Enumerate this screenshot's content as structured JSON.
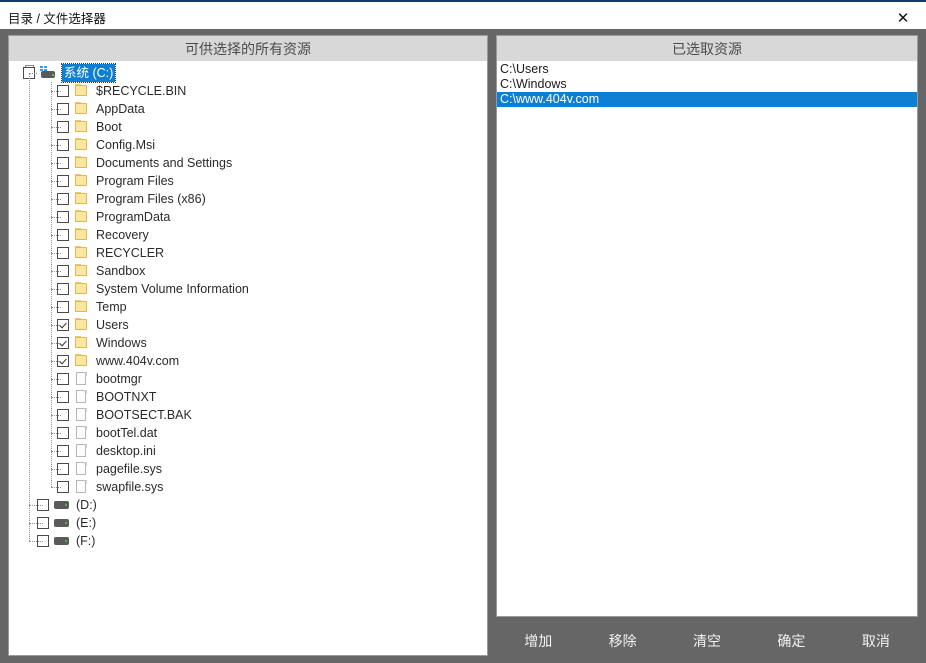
{
  "window": {
    "title": "目录 / 文件选择器",
    "close_icon": "close-icon"
  },
  "colors": {
    "accent_top": "#123a63",
    "selection_blue": "#0f7fd4",
    "chrome_gray": "#666666",
    "panel_header_gray": "#d8d8d8",
    "folder_yellow": "#fbe7a1"
  },
  "left_panel": {
    "header": "可供选择的所有资源",
    "root": {
      "label": "系统 (C:)",
      "icon": "system-drive-icon",
      "checked": false,
      "selected": true,
      "expanded": true
    },
    "children": [
      {
        "label": "$RECYCLE.BIN",
        "icon": "folder-icon",
        "checked": false
      },
      {
        "label": "AppData",
        "icon": "folder-icon",
        "checked": false
      },
      {
        "label": "Boot",
        "icon": "folder-icon",
        "checked": false
      },
      {
        "label": "Config.Msi",
        "icon": "folder-icon",
        "checked": false
      },
      {
        "label": "Documents and Settings",
        "icon": "folder-icon",
        "checked": false
      },
      {
        "label": "Program Files",
        "icon": "folder-icon",
        "checked": false
      },
      {
        "label": "Program Files (x86)",
        "icon": "folder-icon",
        "checked": false
      },
      {
        "label": "ProgramData",
        "icon": "folder-icon",
        "checked": false
      },
      {
        "label": "Recovery",
        "icon": "folder-icon",
        "checked": false
      },
      {
        "label": "RECYCLER",
        "icon": "folder-icon",
        "checked": false
      },
      {
        "label": "Sandbox",
        "icon": "folder-icon",
        "checked": false
      },
      {
        "label": "System Volume Information",
        "icon": "folder-icon",
        "checked": false
      },
      {
        "label": "Temp",
        "icon": "folder-icon",
        "checked": false
      },
      {
        "label": "Users",
        "icon": "folder-icon",
        "checked": true
      },
      {
        "label": "Windows",
        "icon": "folder-icon",
        "checked": true
      },
      {
        "label": "www.404v.com",
        "icon": "folder-icon",
        "checked": true
      },
      {
        "label": "bootmgr",
        "icon": "file-icon",
        "checked": false
      },
      {
        "label": "BOOTNXT",
        "icon": "file-icon",
        "checked": false
      },
      {
        "label": "BOOTSECT.BAK",
        "icon": "file-icon",
        "checked": false
      },
      {
        "label": "bootTel.dat",
        "icon": "file-icon",
        "checked": false
      },
      {
        "label": "desktop.ini",
        "icon": "file-icon",
        "checked": false
      },
      {
        "label": "pagefile.sys",
        "icon": "file-icon",
        "checked": false
      },
      {
        "label": "swapfile.sys",
        "icon": "file-icon",
        "checked": false
      }
    ],
    "drives": [
      {
        "label": "(D:)",
        "icon": "drive-icon",
        "checked": false
      },
      {
        "label": "(E:)",
        "icon": "drive-icon",
        "checked": false
      },
      {
        "label": "(F:)",
        "icon": "drive-icon",
        "checked": false
      }
    ]
  },
  "right_panel": {
    "header": "已选取资源",
    "items": [
      {
        "path": "C:\\Users",
        "selected": false
      },
      {
        "path": "C:\\Windows",
        "selected": false
      },
      {
        "path": "C:\\www.404v.com",
        "selected": true
      }
    ]
  },
  "buttons": [
    {
      "label": "增加",
      "name": "add-button"
    },
    {
      "label": "移除",
      "name": "remove-button"
    },
    {
      "label": "清空",
      "name": "clear-button"
    },
    {
      "label": "确定",
      "name": "confirm-button"
    },
    {
      "label": "取消",
      "name": "cancel-button"
    }
  ]
}
